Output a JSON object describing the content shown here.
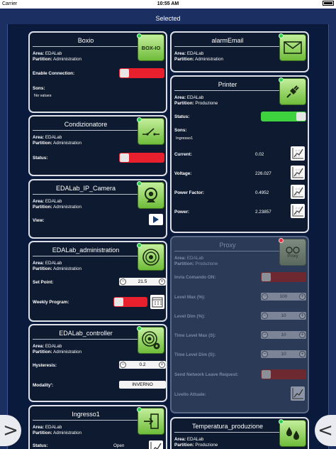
{
  "status_bar": {
    "carrier": "Carrier",
    "time": "10:55 AM"
  },
  "nav": {
    "title": "Selected"
  },
  "labels": {
    "area": "Area:",
    "partition": "Partition:"
  },
  "cards": {
    "boxio": {
      "title": "Boxio",
      "icon_text": "BOX-IO",
      "area": "EDALab",
      "partition": "Administration",
      "enable_label": "Enable Connection:",
      "enable_state": "off",
      "sons_label": "Sons:",
      "sons_value": "No values"
    },
    "alarm": {
      "title": "alarmEmail",
      "area": "EDALab",
      "partition": "Administration"
    },
    "condizionatore": {
      "title": "Condizionatore",
      "area": "EDALab",
      "partition": "Administration",
      "status_label": "Status:",
      "status_state": "off"
    },
    "printer": {
      "title": "Printer",
      "area": "EDALab",
      "partition": "Produzione",
      "status_label": "Status:",
      "status_state": "on",
      "sons_label": "Sons:",
      "sons_value": "Ingresso1",
      "rows": [
        {
          "label": "Current:",
          "value": "0.02"
        },
        {
          "label": "Voltage:",
          "value": "226.027"
        },
        {
          "label": "Power Factor:",
          "value": "0.4952"
        },
        {
          "label": "Power:",
          "value": "2.23857"
        }
      ]
    },
    "camera": {
      "title": "EDALab_IP_Camera",
      "area": "EDALab",
      "partition": "Administration",
      "view_label": "View:"
    },
    "proxy": {
      "title": "Proxy",
      "icon_text": "Proxy",
      "area": "EDALab",
      "partition": "Produzione",
      "cmd_label": "Invia Comando ON:",
      "level_max_label": "Level Max (%):",
      "level_max_value": "100",
      "level_dim_label": "Level Dim (%):",
      "level_dim_value": "10",
      "time_max_label": "Time Level Max (S):",
      "time_max_value": "10",
      "time_dim_label": "Time Level Dim (S):",
      "time_dim_value": "10",
      "leave_label": "Send Network Leave Request:",
      "livello_label": "Livello Attuale:"
    },
    "administration": {
      "title": "EDALab_administration",
      "area": "EDALab",
      "partition": "Administration",
      "setpoint_label": "Set Point:",
      "setpoint_value": "21.5",
      "weekly_label": "Weekly Program:",
      "weekly_state": "off"
    },
    "controller": {
      "title": "EDALab_controller",
      "area": "EDALab",
      "partition": "Administration",
      "hysteresis_label": "Hysteresis:",
      "hysteresis_value": "0.2",
      "modality_label": "Modality':",
      "modality_value": "INVERNO"
    },
    "ingresso": {
      "title": "Ingresso1",
      "area": "EDALab",
      "partition": "Administration",
      "status_label": "Status:",
      "status_value": "Open"
    },
    "temperatura": {
      "title": "Temperatura_produzione",
      "area": "EDALab",
      "partition": "Produzione"
    }
  },
  "colors": {
    "toggle_on": "#3ed23e",
    "toggle_off": "#e8202e",
    "icon_green": "#8fd457"
  }
}
